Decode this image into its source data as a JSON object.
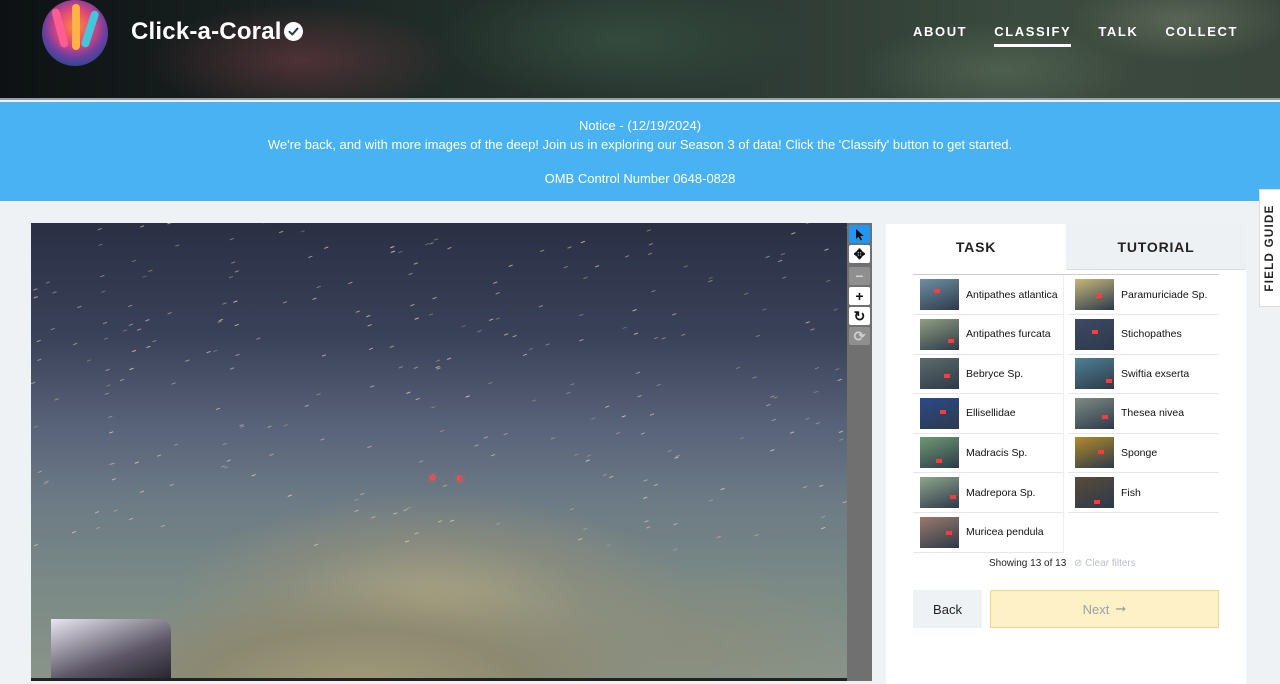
{
  "header": {
    "project_title": "Click-a-Coral",
    "nav": [
      {
        "label": "ABOUT",
        "active": false
      },
      {
        "label": "CLASSIFY",
        "active": true
      },
      {
        "label": "TALK",
        "active": false
      },
      {
        "label": "COLLECT",
        "active": false
      }
    ]
  },
  "notice": {
    "title": "Notice - (12/19/2024)",
    "message": "We're back, and with more images of the deep! Join us in exploring our Season 3 of data! Click the 'Classify' button to get started.",
    "omb": "OMB Control Number 0648-0828"
  },
  "toolbar": {
    "tools": [
      "pointer-icon",
      "move-icon",
      "zoom-out-icon",
      "zoom-in-icon",
      "rotate-icon",
      "reset-icon"
    ]
  },
  "panel": {
    "tabs": {
      "task": "TASK",
      "tutorial": "TUTORIAL"
    },
    "choices": [
      {
        "label": "Antipathes atlantica",
        "thumb": "#6f8fa4"
      },
      {
        "label": "Paramuriciade Sp.",
        "thumb": "#c7b77a"
      },
      {
        "label": "Antipathes furcata",
        "thumb": "#8f9e7f"
      },
      {
        "label": "Stichopathes",
        "thumb": "#3d4967"
      },
      {
        "label": "Bebryce Sp.",
        "thumb": "#5c6b6a"
      },
      {
        "label": "Swiftia exserta",
        "thumb": "#4f7f94"
      },
      {
        "label": "Ellisellidae",
        "thumb": "#2c4a8a"
      },
      {
        "label": "Thesea nivea",
        "thumb": "#7e8b84"
      },
      {
        "label": "Madracis Sp.",
        "thumb": "#6e9a72"
      },
      {
        "label": "Sponge",
        "thumb": "#b28a2c"
      },
      {
        "label": "Madrepora Sp.",
        "thumb": "#8fa58b"
      },
      {
        "label": "Fish",
        "thumb": "#5a4a3a"
      },
      {
        "label": "Muricea pendula",
        "thumb": "#9a7a6a"
      }
    ],
    "showing": "Showing 13 of 13",
    "clear_filters": "Clear filters",
    "back_label": "Back",
    "next_label": "Next"
  },
  "field_guide": "FIELD GUIDE"
}
